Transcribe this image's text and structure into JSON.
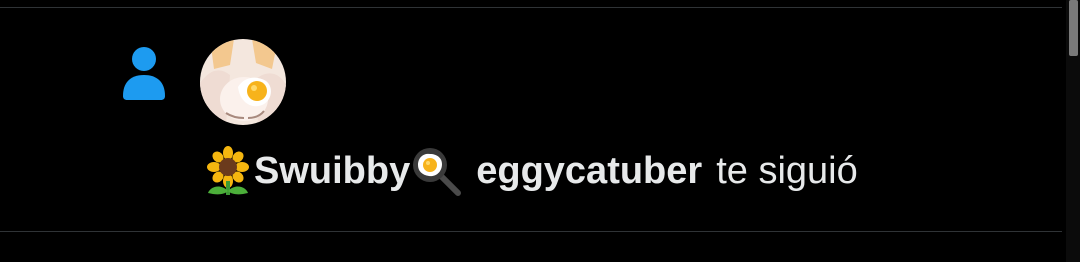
{
  "notification": {
    "type": "follow",
    "icon": "person-icon",
    "avatar": "avatar-image",
    "display_name": "Swuibby",
    "name_prefix_emoji": "sunflower-icon",
    "name_suffix_emoji": "fried-egg-pan-icon",
    "username": "eggycatuber",
    "action_text": "te siguió"
  },
  "colors": {
    "background": "#000000",
    "accent": "#1d9bf0",
    "text": "#e7e9ea",
    "divider": "#2f3336"
  }
}
